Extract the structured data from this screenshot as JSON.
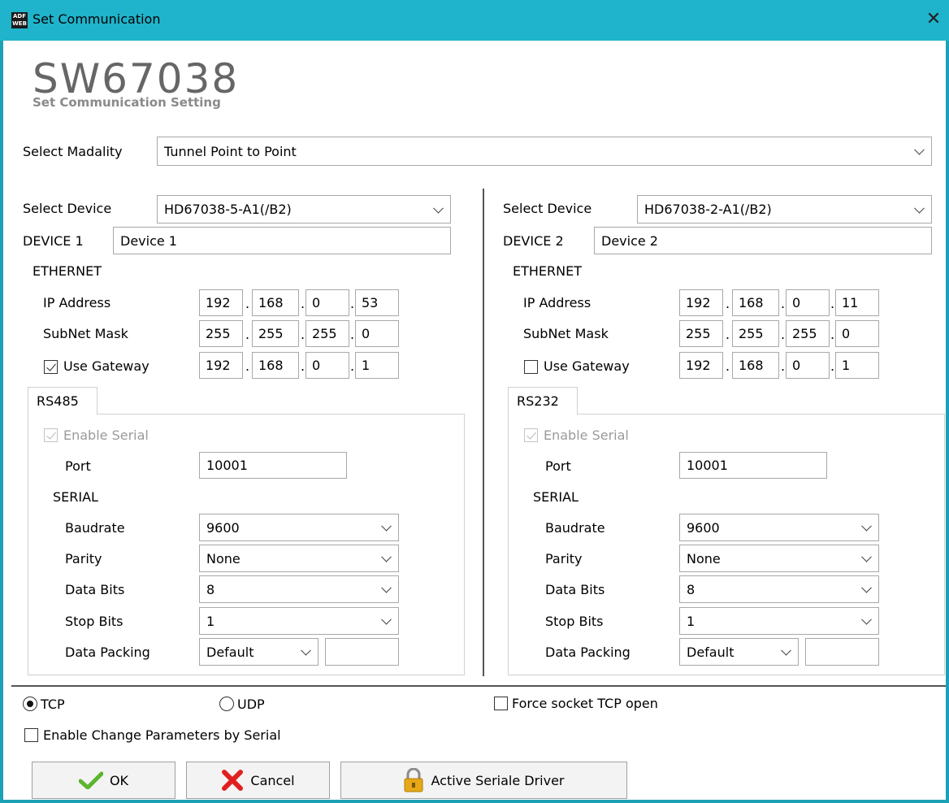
{
  "window": {
    "title": "Set Communication",
    "app_icon_top": "ADF",
    "app_icon_bottom": "WEB"
  },
  "header": {
    "title": "SW67038",
    "subtitle": "Set Communication Setting"
  },
  "modality": {
    "label": "Select Madality",
    "value": "Tunnel Point to Point"
  },
  "device1": {
    "select_label": "Select Device",
    "select_value": "HD67038-5-A1(/B2)",
    "name_label": "DEVICE 1",
    "name_value": "Device 1",
    "ethernet_label": "ETHERNET",
    "ip_label": "IP Address",
    "ip": [
      "192",
      "168",
      "0",
      "53"
    ],
    "mask_label": "SubNet Mask",
    "mask": [
      "255",
      "255",
      "255",
      "0"
    ],
    "gateway_label": "Use Gateway",
    "gateway_checked": true,
    "gateway": [
      "192",
      "168",
      "0",
      "1"
    ],
    "tab_label": "RS485",
    "enable_serial_label": "Enable Serial",
    "port_label": "Port",
    "port_value": "10001",
    "serial_label": "SERIAL",
    "baudrate_label": "Baudrate",
    "baudrate_value": "9600",
    "parity_label": "Parity",
    "parity_value": "None",
    "databits_label": "Data Bits",
    "databits_value": "8",
    "stopbits_label": "Stop Bits",
    "stopbits_value": "1",
    "packing_label": "Data Packing",
    "packing_value": "Default",
    "packing_extra": ""
  },
  "device2": {
    "select_label": "Select Device",
    "select_value": "HD67038-2-A1(/B2)",
    "name_label": "DEVICE 2",
    "name_value": "Device 2",
    "ethernet_label": "ETHERNET",
    "ip_label": "IP Address",
    "ip": [
      "192",
      "168",
      "0",
      "11"
    ],
    "mask_label": "SubNet Mask",
    "mask": [
      "255",
      "255",
      "255",
      "0"
    ],
    "gateway_label": "Use Gateway",
    "gateway_checked": false,
    "gateway": [
      "192",
      "168",
      "0",
      "1"
    ],
    "tab_label": "RS232",
    "enable_serial_label": "Enable Serial",
    "port_label": "Port",
    "port_value": "10001",
    "serial_label": "SERIAL",
    "baudrate_label": "Baudrate",
    "baudrate_value": "9600",
    "parity_label": "Parity",
    "parity_value": "None",
    "databits_label": "Data Bits",
    "databits_value": "8",
    "stopbits_label": "Stop Bits",
    "stopbits_value": "1",
    "packing_label": "Data Packing",
    "packing_value": "Default",
    "packing_extra": ""
  },
  "protocol": {
    "tcp_label": "TCP",
    "udp_label": "UDP",
    "selected": "TCP",
    "force_label": "Force socket TCP open",
    "change_params_label": "Enable Change Parameters by Serial"
  },
  "buttons": {
    "ok": "OK",
    "cancel": "Cancel",
    "driver": "Active Seriale Driver"
  }
}
